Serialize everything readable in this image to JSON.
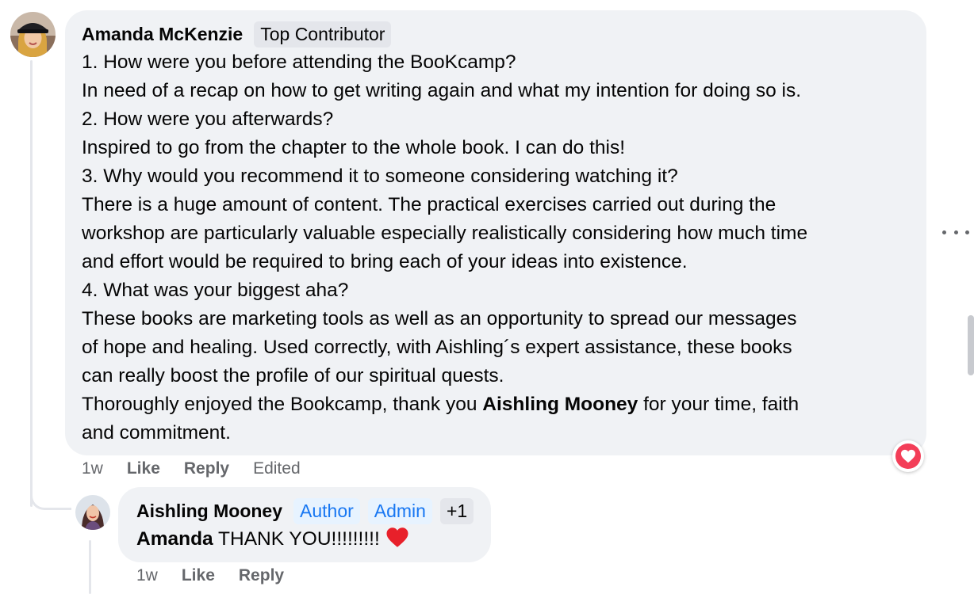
{
  "comment": {
    "author": "Amanda McKenzie",
    "badge": "Top Contributor",
    "lines": [
      {
        "text": "1. How were you before attending the BooKcamp?"
      },
      {
        "text": "In need of a recap on how to get writing again and what my intention for doing so is."
      },
      {
        "text": "2. How were you afterwards?"
      },
      {
        "text": "Inspired to go from the chapter to the whole book. I can do this!"
      },
      {
        "text": "3. Why would you recommend it to someone considering watching it?"
      },
      {
        "text": "There is a huge amount of content. The practical exercises carried out during the"
      },
      {
        "text": "workshop are particularly valuable especially realistically considering how much time"
      },
      {
        "text": "and effort would be required to bring each of your ideas into existence."
      },
      {
        "text": "4. What was your biggest aha?"
      },
      {
        "text": "These books are marketing tools as well as an opportunity to spread our messages"
      },
      {
        "text": "of hope and healing. Used correctly, with Aishling´s expert assistance, these books"
      },
      {
        "text": "can really boost the profile of our spiritual quests."
      },
      {
        "pre": "Thoroughly enjoyed the Bookcamp, thank you ",
        "mention": "Aishling Mooney",
        "post": " for your time, faith"
      },
      {
        "text": "and commitment."
      }
    ],
    "time": "1w",
    "like_label": "Like",
    "reply_label": "Reply",
    "edited_label": "Edited",
    "reaction_icon": "heart-reaction-icon",
    "reaction_color": "#f33e58"
  },
  "reply": {
    "author": "Aishling Mooney",
    "badges": [
      "Author",
      "Admin"
    ],
    "badge_more": "+1",
    "mention": "Amanda",
    "text": " THANK YOU!!!!!!!!! ",
    "emoji_icon": "red-heart-emoji-icon",
    "time": "1w",
    "like_label": "Like",
    "reply_label": "Reply"
  },
  "colors": {
    "bubble": "#f0f2f5",
    "secondary_text": "#65676b",
    "badge_blue": "#1877f2"
  }
}
